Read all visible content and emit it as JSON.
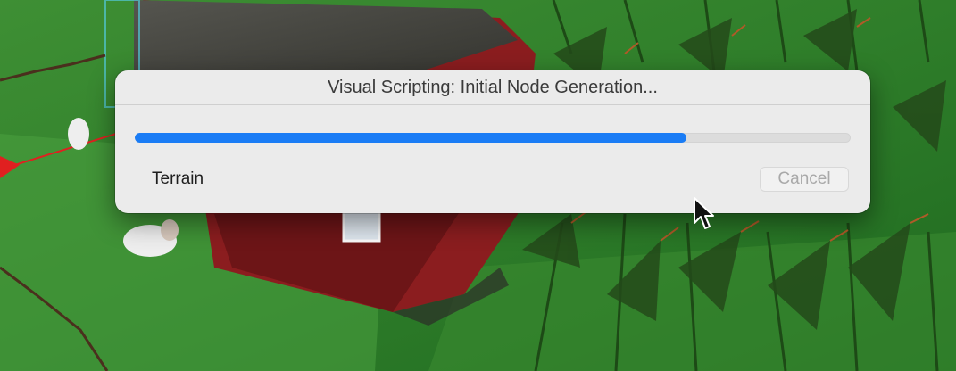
{
  "dialog": {
    "title": "Visual Scripting: Initial Node Generation...",
    "progress": 0.77,
    "status": "Terrain",
    "cancel_label": "Cancel"
  },
  "colors": {
    "accent": "#1a7cf5",
    "dialog_bg": "#ebebeb",
    "grass": "#2f7a2a",
    "barn_red": "#8b1d1f",
    "barn_roof": "#3f3f3c"
  }
}
